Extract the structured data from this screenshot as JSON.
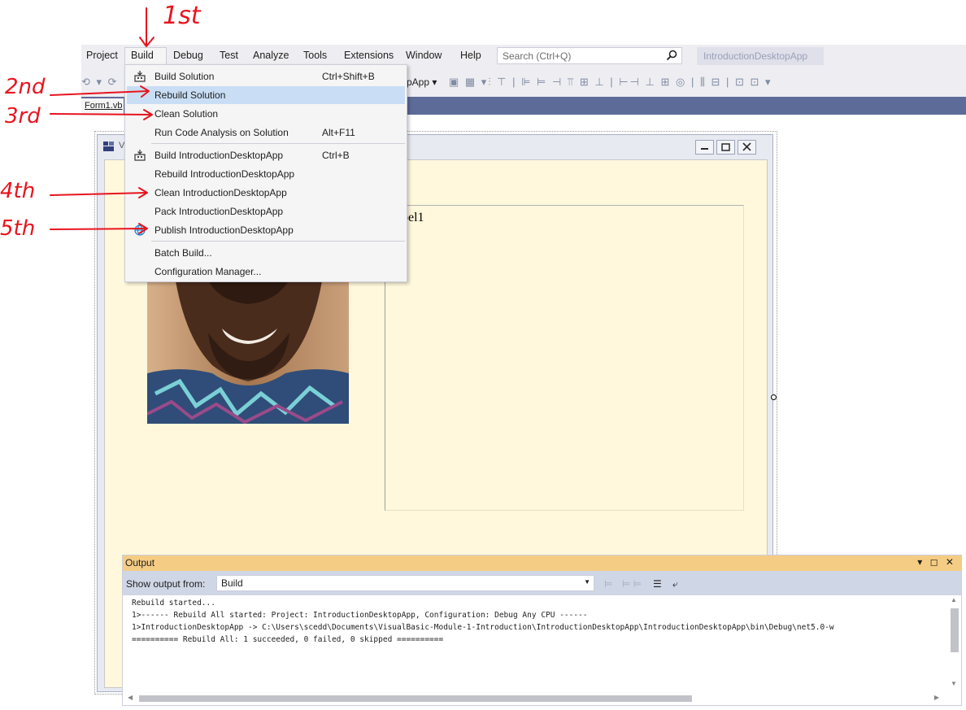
{
  "menubar": {
    "items": [
      "Project",
      "Build",
      "Debug",
      "Test",
      "Analyze",
      "Tools",
      "Extensions",
      "Window",
      "Help"
    ],
    "search_placeholder": "Search (Ctrl+Q)",
    "app_title": "IntroductionDesktopApp"
  },
  "toolbar": {
    "app_fragment": "pApp ▾"
  },
  "doc_tabs": {
    "active": "Form1.vb"
  },
  "build_menu": {
    "items": [
      {
        "label": "Build Solution",
        "shortcut": "Ctrl+Shift+B",
        "icon": "build-icon"
      },
      {
        "label": "Rebuild Solution",
        "shortcut": "",
        "icon": ""
      },
      {
        "label": "Clean Solution",
        "shortcut": "",
        "icon": ""
      },
      {
        "label": "Run Code Analysis on Solution",
        "shortcut": "Alt+F11",
        "icon": ""
      },
      {
        "label": "Build IntroductionDesktopApp",
        "shortcut": "Ctrl+B",
        "icon": "build-icon"
      },
      {
        "label": "Rebuild IntroductionDesktopApp",
        "shortcut": "",
        "icon": ""
      },
      {
        "label": "Clean IntroductionDesktopApp",
        "shortcut": "",
        "icon": ""
      },
      {
        "label": "Pack IntroductionDesktopApp",
        "shortcut": "",
        "icon": ""
      },
      {
        "label": "Publish IntroductionDesktopApp",
        "shortcut": "",
        "icon": "globe-icon"
      },
      {
        "label": "Batch Build...",
        "shortcut": "",
        "icon": ""
      },
      {
        "label": "Configuration Manager...",
        "shortcut": "",
        "icon": ""
      }
    ],
    "highlighted_index": 1
  },
  "designer": {
    "form_title_fragment": "V",
    "label_text": "bel1"
  },
  "output": {
    "title": "Output",
    "window_controls": "▾ ◻ ✕",
    "show_from_label": "Show output from:",
    "source": "Build",
    "lines": [
      "Rebuild started...",
      "1>------ Rebuild All started: Project: IntroductionDesktopApp, Configuration: Debug Any CPU ------",
      "1>IntroductionDesktopApp -> C:\\Users\\scedd\\Documents\\VisualBasic-Module-1-Introduction\\IntroductionDesktopApp\\IntroductionDesktopApp\\bin\\Debug\\net5.0-w",
      "========== Rebuild All: 1 succeeded, 0 failed, 0 skipped =========="
    ]
  },
  "annotations": {
    "first": "1st",
    "second": "2nd",
    "third": "3rd",
    "fourth": "4th",
    "fifth": "5th",
    "color": "#e8141e"
  },
  "colors": {
    "menu_highlight": "#c9def5",
    "tab_strip": "#5d6b99",
    "output_title": "#f5cc84",
    "form_client": "#fff8dc"
  }
}
